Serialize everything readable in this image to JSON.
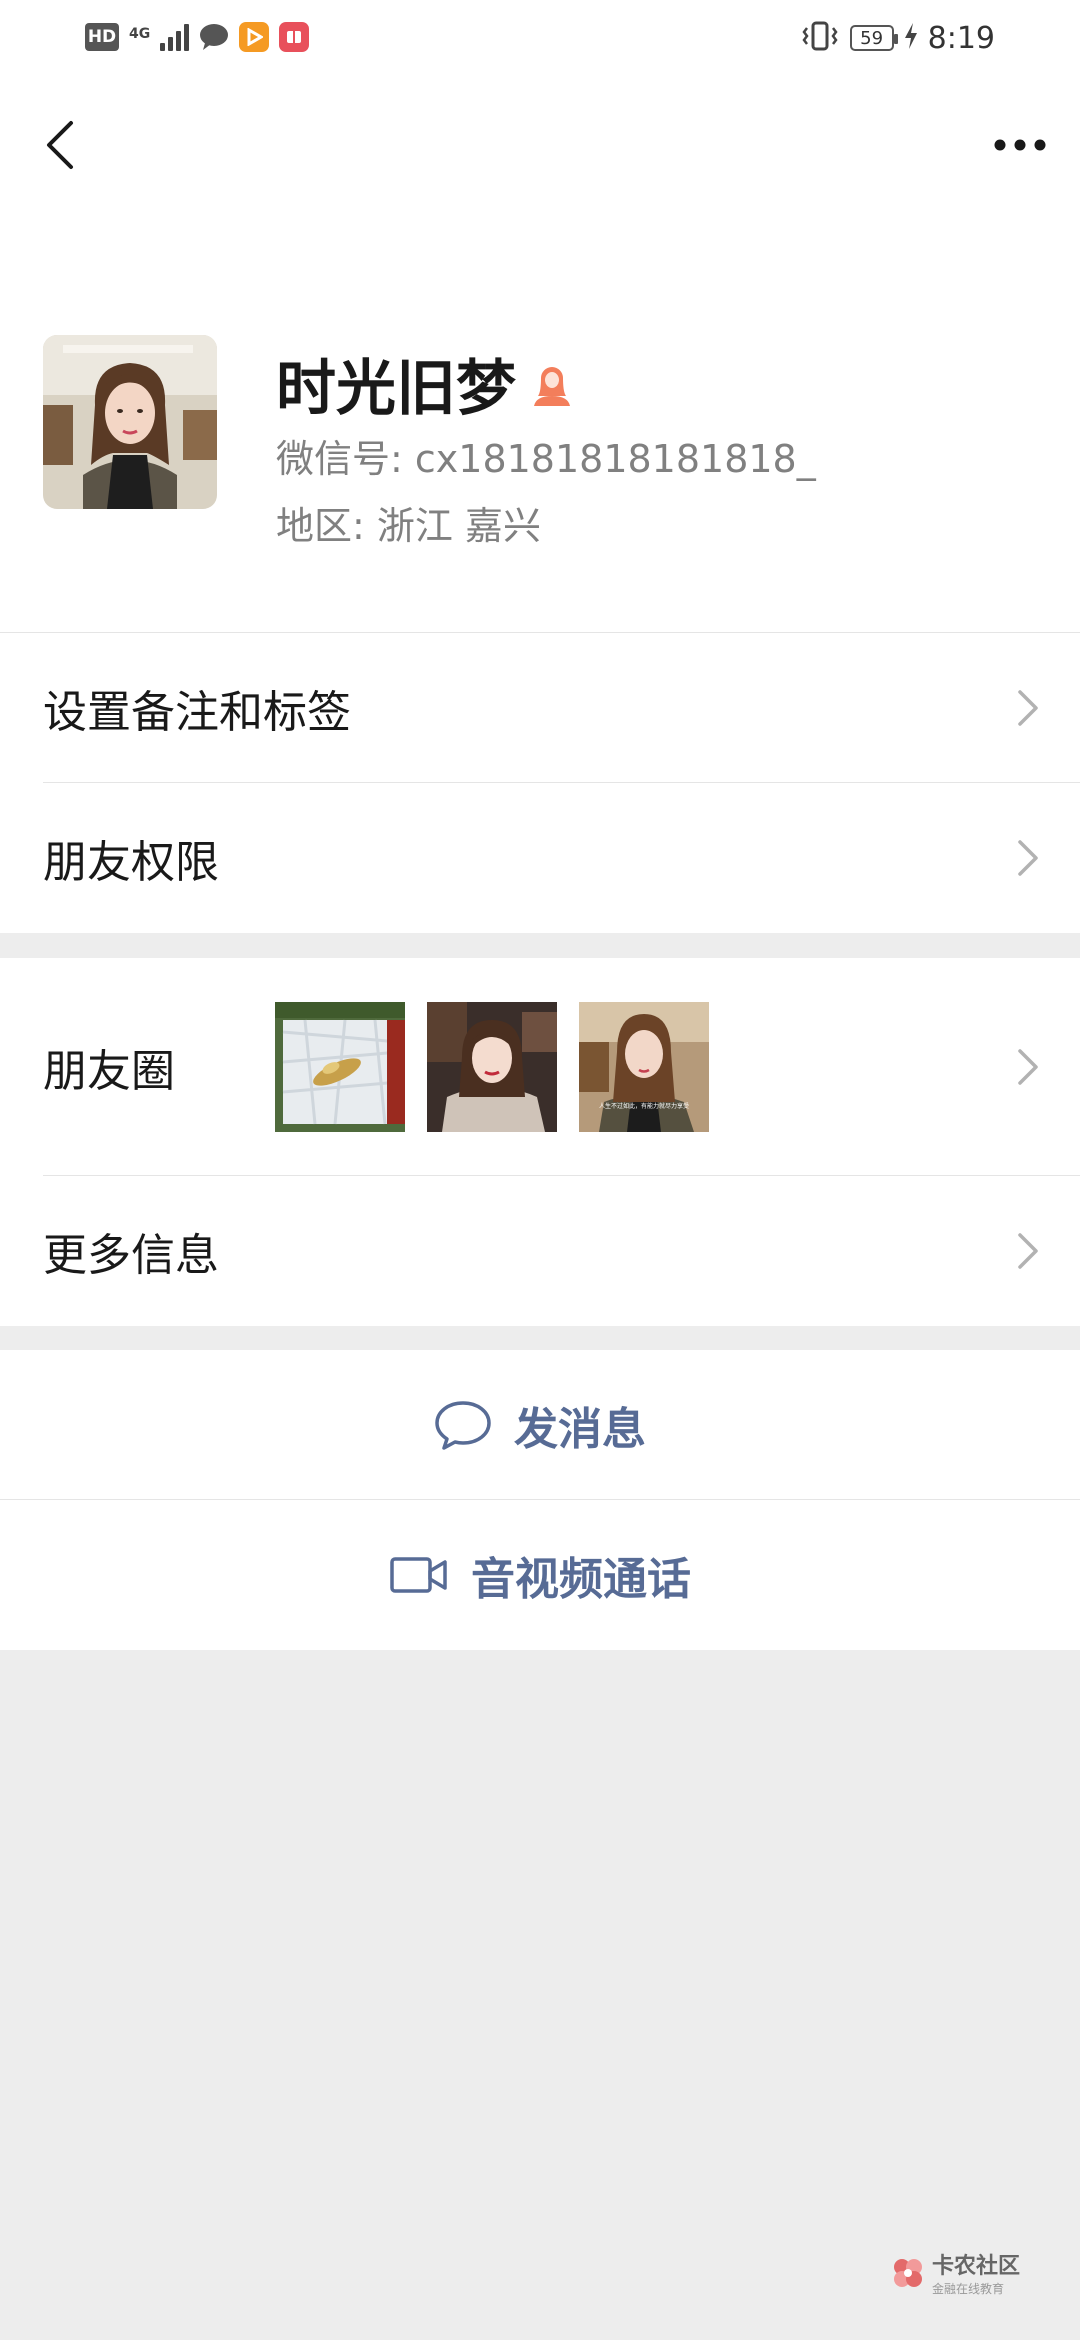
{
  "status_bar": {
    "hd": "HD",
    "network": "4G",
    "battery": "59",
    "time": "8:19"
  },
  "profile": {
    "name": "时光旧梦",
    "wechat_id": "微信号: cx18181818181818_",
    "region": "地区: 浙江  嘉兴",
    "gender_icon": "female-icon",
    "gender_color": "#f37e5b"
  },
  "menu": {
    "remark_tags": "设置备注和标签",
    "friend_permissions": "朋友权限",
    "moments": "朋友圈",
    "more_info": "更多信息"
  },
  "moments_thumbs": [
    {
      "caption": ""
    },
    {
      "caption": ""
    },
    {
      "caption": "人生不过如此，有能力就尽力享受"
    }
  ],
  "actions": {
    "send_message": "发消息",
    "video_call": "音视频通话"
  },
  "watermark": {
    "title": "卡农社区",
    "subtitle": "金融在线教育"
  },
  "colors": {
    "link": "#576b95",
    "background": "#ededed"
  }
}
